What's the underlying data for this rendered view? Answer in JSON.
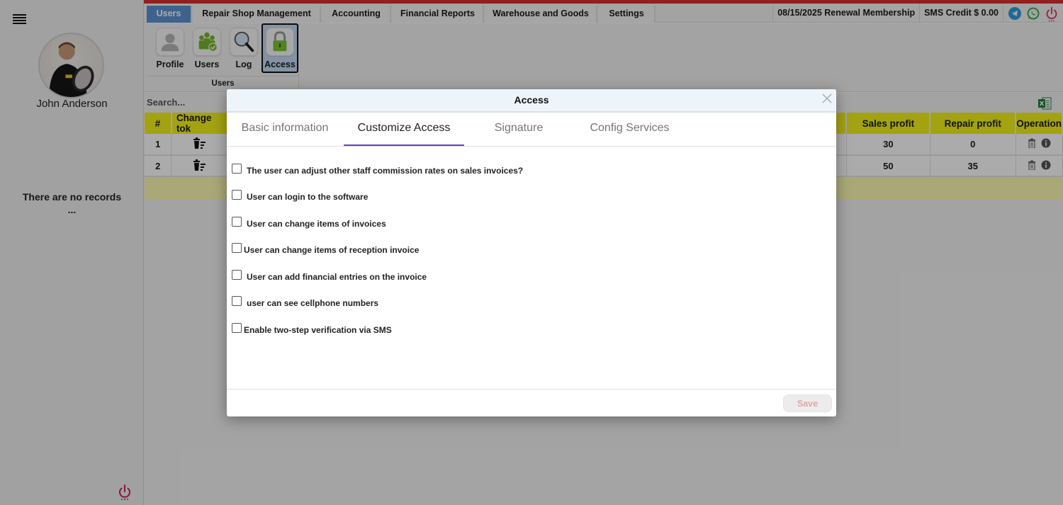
{
  "sidebar": {
    "menu_icon": "hamburger-menu-icon",
    "user_name": "John Anderson",
    "empty_message": "There are no records",
    "empty_ellipsis": "...",
    "power_icon": "power-icon"
  },
  "menubar": {
    "tabs": [
      {
        "label": "Users",
        "active": true
      },
      {
        "label": "Repair Shop Management",
        "active": false
      },
      {
        "label": "Accounting",
        "active": false
      },
      {
        "label": "Financial Reports",
        "active": false
      },
      {
        "label": "Warehouse and Goods",
        "active": false
      },
      {
        "label": "Settings",
        "active": false
      }
    ],
    "renewal": "08/15/2025 Renewal Membership",
    "sms_credit": "SMS Credit $ 0.00",
    "icons": [
      "telegram-icon",
      "whatsapp-icon",
      "power-icon"
    ],
    "accent_color": "#d9302f",
    "active_tab_color": "#5d92cf"
  },
  "ribbon": {
    "buttons": [
      {
        "label": "Profile",
        "icon": "profile-icon",
        "active": false
      },
      {
        "label": "Users",
        "icon": "users-group-icon",
        "active": false
      },
      {
        "label": "Log",
        "icon": "magnifier-icon",
        "active": false
      },
      {
        "label": "Access",
        "icon": "lock-icon",
        "active": true
      }
    ],
    "group_label": "Users"
  },
  "main": {
    "search_placeholder": "Search...",
    "export_icon": "excel-icon",
    "table": {
      "columns": [
        "#",
        "Change tok",
        "Sales profit",
        "Repair profit",
        "Operation"
      ],
      "header_color": "#f4f21a",
      "rows": [
        {
          "index": "1",
          "sales_profit": "30",
          "repair_profit": "0"
        },
        {
          "index": "2",
          "sales_profit": "50",
          "repair_profit": "35"
        }
      ]
    }
  },
  "modal": {
    "title": "Access",
    "close_icon": "close-icon",
    "tabs": [
      {
        "label": "Basic information",
        "active": false
      },
      {
        "label": "Customize Access",
        "active": true
      },
      {
        "label": "Signature",
        "active": false
      },
      {
        "label": "Config Services",
        "active": false
      }
    ],
    "options": [
      {
        "label": "The user can adjust other staff commission rates on sales invoices?",
        "checked": false
      },
      {
        "label": "User can login to the software",
        "checked": false
      },
      {
        "label": "User can change items of invoices",
        "checked": false
      },
      {
        "label": "User can change items of reception invoice",
        "checked": false
      },
      {
        "label": "User can add financial entries on the invoice",
        "checked": false
      },
      {
        "label": "user can see cellphone numbers",
        "checked": false
      },
      {
        "label": "Enable two-step verification via SMS",
        "checked": false
      }
    ],
    "save_label": "Save",
    "active_tab_color": "#6a3ec8"
  }
}
